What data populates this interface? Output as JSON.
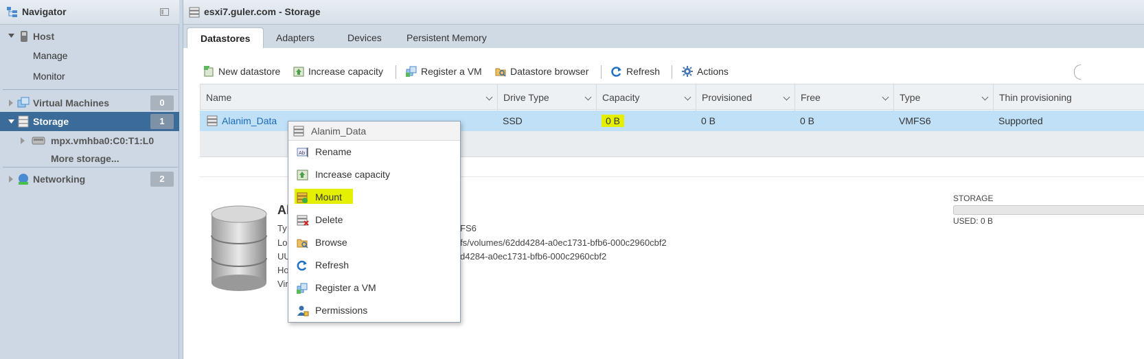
{
  "navigator": {
    "title": "Navigator",
    "host": "Host",
    "manage": "Manage",
    "monitor": "Monitor",
    "vms": "Virtual Machines",
    "vms_count": "0",
    "storage": "Storage",
    "storage_count": "1",
    "device": "mpx.vmhba0:C0:T1:L0",
    "more_storage": "More storage...",
    "networking": "Networking",
    "networking_count": "2"
  },
  "main": {
    "title": "esxi7.guler.com - Storage",
    "tabs": [
      "Datastores",
      "Adapters",
      "Devices",
      "Persistent Memory"
    ]
  },
  "toolbar": {
    "new_datastore": "New datastore",
    "increase_capacity": "Increase capacity",
    "register_vm": "Register a VM",
    "datastore_browser": "Datastore browser",
    "refresh": "Refresh",
    "actions": "Actions"
  },
  "table": {
    "columns": [
      "Name",
      "Drive Type",
      "Capacity",
      "Provisioned",
      "Free",
      "Type",
      "Thin provisioning"
    ],
    "row": {
      "name": "Alanim_Data",
      "drive_type": "SSD",
      "capacity": "0 B",
      "provisioned": "0 B",
      "free": "0 B",
      "type": "VMFS6",
      "thin": "Supported"
    }
  },
  "details": {
    "title_partial": "Al",
    "type_label": "Ty",
    "type_value": "FS6",
    "location_label": "Lo",
    "location_value": "fs/volumes/62dd4284-a0ec1731-bfb6-000c2960cbf2",
    "uuid_label": "UU",
    "uuid_value": "d4284-a0ec1731-bfb6-000c2960cbf2",
    "hosts_label": "Ho",
    "vms_label": "Vir",
    "storage_label": "STORAGE",
    "used_label": "USED: 0 B"
  },
  "context_menu": {
    "header": "Alanim_Data",
    "items": [
      "Rename",
      "Increase capacity",
      "Mount",
      "Delete",
      "Browse",
      "Refresh",
      "Register a VM",
      "Permissions"
    ]
  },
  "colors": {
    "selected_nav": "#3a6b99",
    "selected_row": "#bfe0f7",
    "highlight": "#e4f000",
    "link": "#1a6ab8"
  }
}
